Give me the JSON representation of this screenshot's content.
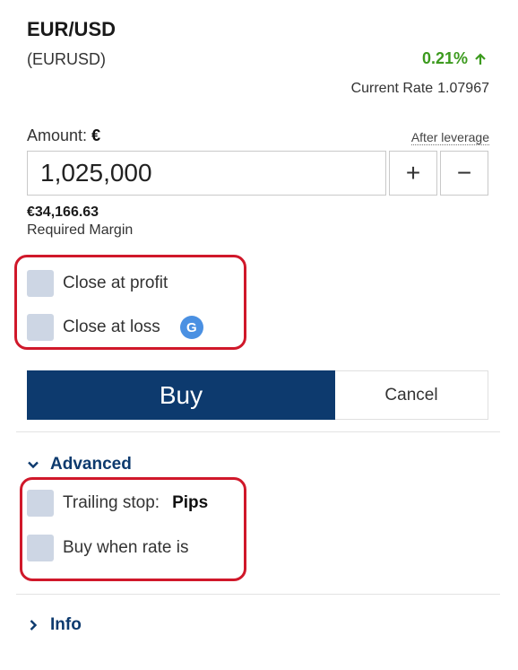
{
  "instrument": {
    "title": "EUR/USD",
    "symbol": "(EURUSD)",
    "change": "0.21%",
    "current_rate_label": "Current Rate",
    "current_rate_value": "1.07967"
  },
  "amount": {
    "label": "Amount:",
    "currency": "€",
    "after_leverage": "After leverage",
    "value": "1,025,000",
    "plus": "+",
    "minus": "−"
  },
  "margin": {
    "value": "€34,166.63",
    "label": "Required Margin"
  },
  "options": {
    "close_at_profit": "Close at profit",
    "close_at_loss": "Close at loss",
    "badge": "G"
  },
  "actions": {
    "buy": "Buy",
    "cancel": "Cancel"
  },
  "advanced": {
    "label": "Advanced",
    "trailing_stop": "Trailing stop:",
    "trailing_unit": "Pips",
    "buy_when_rate": "Buy when rate is"
  },
  "info": {
    "label": "Info"
  },
  "colors": {
    "accent": "#0d3a6e",
    "positive": "#3c9a1e",
    "highlight": "#d0182a",
    "checkbox": "#cdd6e4"
  }
}
